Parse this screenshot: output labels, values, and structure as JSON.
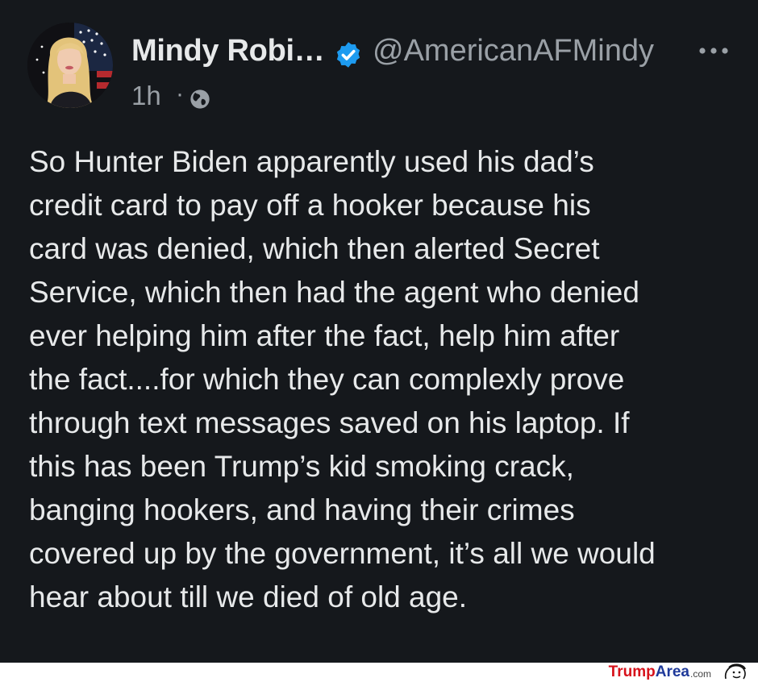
{
  "post": {
    "author_name": "Mindy Robi…",
    "handle": "@AmericanAFMindy",
    "timestamp": "1h",
    "separator": "·",
    "verified_color": "#1d9bf0",
    "text_lines": [
      "So Hunter Biden apparently used his dad’s",
      "credit card to pay off a hooker because his",
      "card was denied, which then alerted Secret",
      "Service, which then had the agent who denied",
      "ever helping him after the fact, help him after",
      "the fact....for which they can complexly prove",
      "through text messages saved on his laptop. If",
      "this has been Trump’s kid smoking crack,",
      "banging hookers, and having their crimes",
      "covered up by the government, it’s all we would",
      "hear about till we died of old age."
    ],
    "icons": {
      "verified": "verified-badge-icon",
      "more": "more-options-icon",
      "visibility": "globe-icon"
    }
  },
  "watermark": {
    "part1": "Trump",
    "part2": "Area",
    "part3": ".com"
  }
}
